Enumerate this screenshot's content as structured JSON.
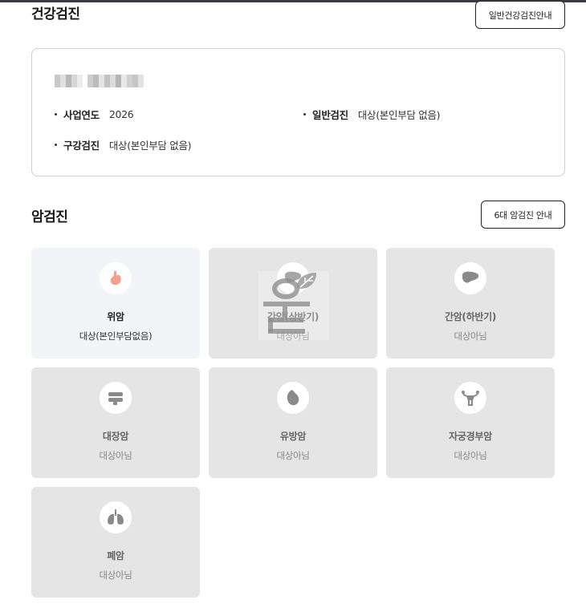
{
  "health_checkup": {
    "title": "건강검진",
    "guide_button": "일반건강검진안내",
    "info": {
      "year_label": "사업연도",
      "year_value": "2026",
      "general_label": "일반검진",
      "general_value": "대상(본인부담 없음)",
      "oral_label": "구강검진",
      "oral_value": "대상(본인부담 없음)"
    }
  },
  "cancer_checkup": {
    "title": "암검진",
    "guide_button": "6대 암검진 안내",
    "items": [
      {
        "name": "위암",
        "status": "대상(본인부담없음)",
        "icon": "stomach-icon",
        "active": true
      },
      {
        "name": "간암(상반기)",
        "status": "대상아님",
        "icon": "liver-icon",
        "active": false
      },
      {
        "name": "간암(하반기)",
        "status": "대상아님",
        "icon": "liver-icon",
        "active": false
      },
      {
        "name": "대장암",
        "status": "대상아님",
        "icon": "colon-icon",
        "active": false
      },
      {
        "name": "유방암",
        "status": "대상아님",
        "icon": "breast-icon",
        "active": false
      },
      {
        "name": "자궁경부암",
        "status": "대상아님",
        "icon": "uterus-icon",
        "active": false
      },
      {
        "name": "폐암",
        "status": "대상아님",
        "icon": "lungs-icon",
        "active": false
      }
    ]
  },
  "colors": {
    "active_card_bg": "#f3f4f8",
    "inactive_card_bg": "#e5e5e5",
    "stomach_accent": "#f0a08c",
    "icon_gray": "#8a8a8a"
  }
}
